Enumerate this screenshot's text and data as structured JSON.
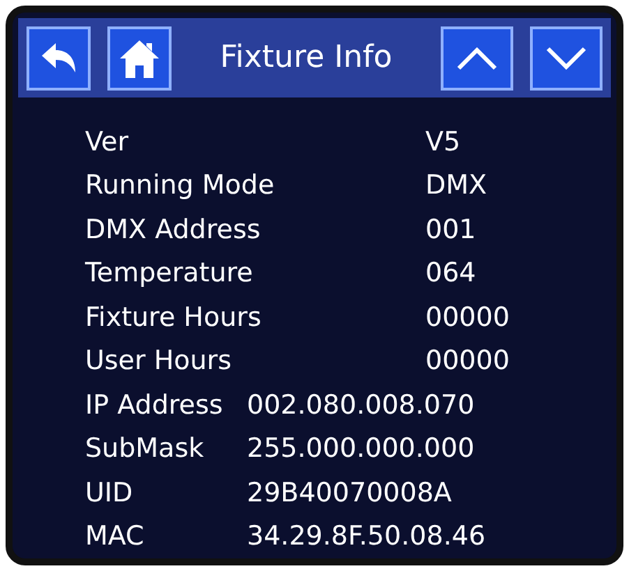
{
  "header": {
    "title": "Fixture Info"
  },
  "rows": [
    {
      "label": "Ver",
      "value": "V5",
      "kind": "aligned"
    },
    {
      "label": "Running Mode",
      "value": "DMX",
      "kind": "aligned"
    },
    {
      "label": "DMX Address",
      "value": "001",
      "kind": "aligned"
    },
    {
      "label": "Temperature",
      "value": "064",
      "kind": "aligned"
    },
    {
      "label": "Fixture Hours",
      "value": "00000",
      "kind": "aligned"
    },
    {
      "label": "User Hours",
      "value": "00000",
      "kind": "aligned"
    },
    {
      "label": "IP Address",
      "value": "002.080.008.070",
      "kind": "compact"
    },
    {
      "label": "SubMask",
      "value": "255.000.000.000",
      "kind": "compact"
    },
    {
      "label": "UID",
      "value": "29B40070008A",
      "kind": "compact"
    },
    {
      "label": "MAC",
      "value": "34.29.8F.50.08.46",
      "kind": "compact"
    }
  ]
}
